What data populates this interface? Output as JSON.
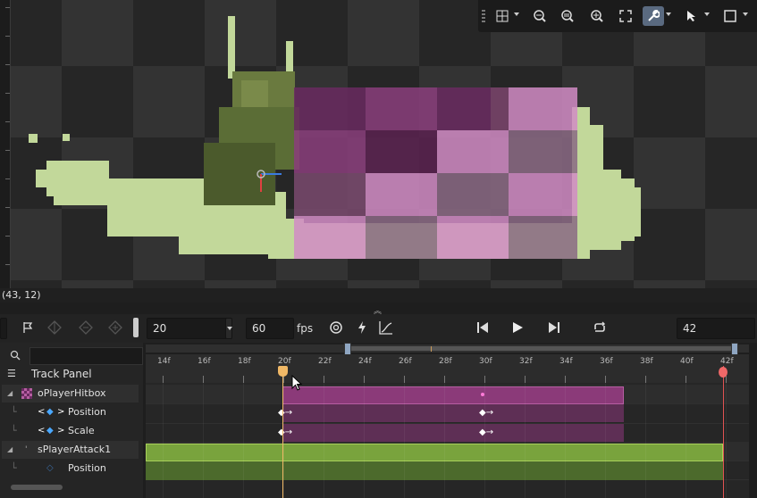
{
  "viewport": {
    "coordinates": "(43, 12)"
  },
  "toolbar": {
    "icons": [
      "grid-icon",
      "zoom-out-icon",
      "zoom-reset-icon",
      "zoom-in-icon",
      "fullscreen-icon",
      "wrench-icon",
      "select-arrow-icon",
      "rectangle-icon"
    ],
    "active_tool": "wrench-icon"
  },
  "animation": {
    "current_frame": "20",
    "speed": "60",
    "speed_unit": "fps",
    "frame_count": "42",
    "track_panel_label": "Track Panel",
    "ruler_ticks": [
      "14f",
      "16f",
      "18f",
      "20f",
      "22f",
      "24f",
      "26f",
      "28f",
      "30f",
      "32f",
      "34f",
      "36f",
      "38f",
      "40f",
      "42f"
    ]
  },
  "tracks": [
    {
      "label": "oPlayerHitbox",
      "type": "object"
    },
    {
      "label": "Position",
      "type": "property"
    },
    {
      "label": "Scale",
      "type": "property"
    },
    {
      "label": "sPlayerAttack1",
      "type": "sprite"
    },
    {
      "label": "Position",
      "type": "property"
    }
  ],
  "colors": {
    "hitbox_clip": "#8b3a79",
    "sprite_clip": "#79a33d",
    "playhead": "#f0b866",
    "end_marker": "#f06868",
    "snail_body": "#c2d89a"
  }
}
